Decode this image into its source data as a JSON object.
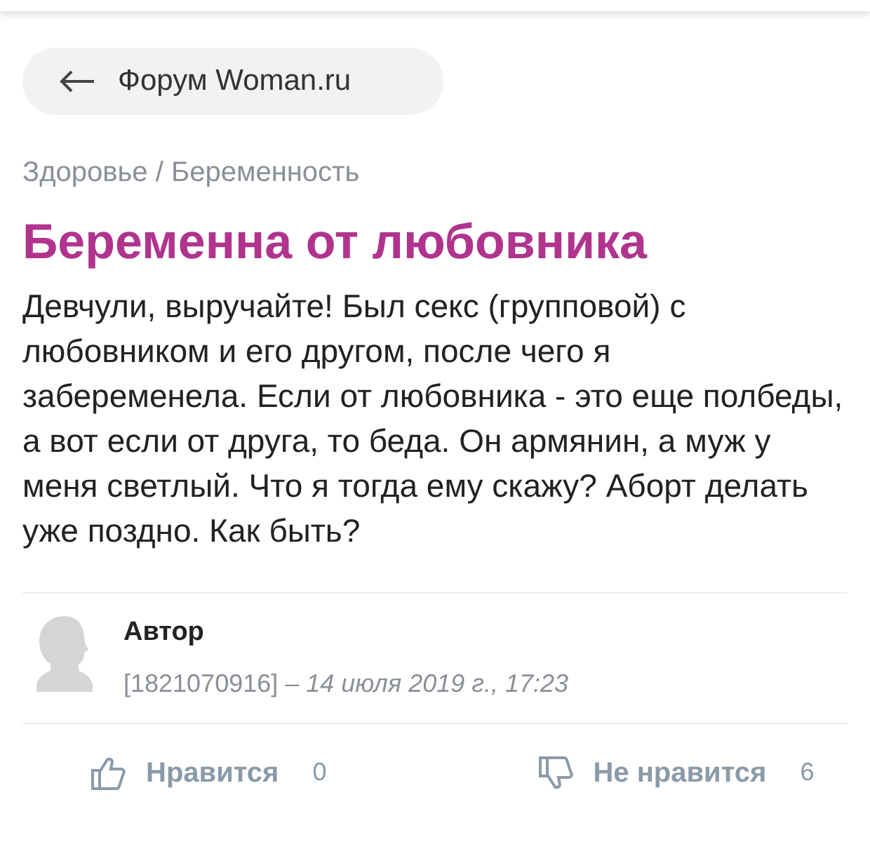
{
  "back_button": {
    "label": "Форум Woman.ru"
  },
  "breadcrumb": "Здоровье / Беременность",
  "title": "Беременна от любовника",
  "body": "Девчули, выручайте! Был секс (групповой) с любовником и его другом, после чего я забеременела. Если от любовника - это еще полбеды, а вот если от друга, то беда. Он армянин, а муж у меня светлый. Что я тогда ему скажу? Аборт делать уже поздно. Как быть?",
  "author": {
    "name": "Автор",
    "meta": "[1821070916] *– 14 июля 2019 г., 17:23*"
  },
  "reactions": [
    {
      "kind": "like",
      "label": "Нравится",
      "count": "0"
    },
    {
      "kind": "dislike",
      "label": "Не нравится",
      "count": "6"
    }
  ]
}
